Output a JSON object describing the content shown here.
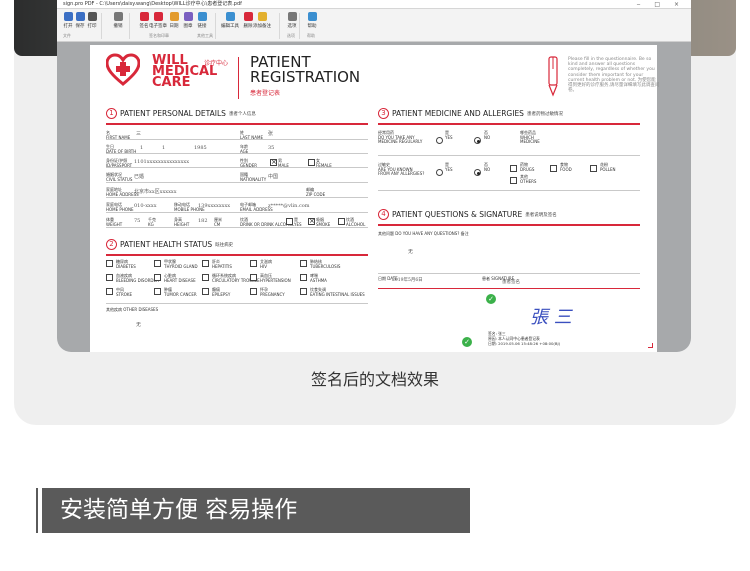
{
  "window": {
    "title": "sign.pro PDF  -  C:\\Users\\daisy.wang\\Desktop\\WILL诊疗中心\\患者登记表.pdf",
    "controls": "‒ □ ×"
  },
  "toolbar": {
    "tools": [
      "打开",
      "保存",
      "打印",
      "撤销",
      "签名",
      "电子签章",
      "日期",
      "图章",
      "链接",
      "编辑工具",
      "删除",
      "添加备注",
      "选项",
      "帮助"
    ],
    "groups": [
      "文件",
      "签名和印章",
      "其他工具",
      "选项",
      "帮助"
    ]
  },
  "document": {
    "brand_line1": "WILL",
    "brand_line2": "MEDICAL",
    "brand_line3": "CARE",
    "brand_cn": "诊疗中心",
    "reg_line1": "PATIENT",
    "reg_line2": "REGISTRATION",
    "reg_cn": "患者登记表",
    "notice": "Please fill in the questionnaire. Be so kind and answer all questions completely, regardless of whether you consider them important for your current health problem or not. 为使您能得到更好的诊疗服务,请尽量详细填写此调查问卷。",
    "sections": {
      "s1": {
        "num": "1",
        "title": "PATIENT PERSONAL DETAILS",
        "cn": "患者个人信息"
      },
      "s2": {
        "num": "2",
        "title": "PATIENT HEALTH STATUS",
        "cn": "既往病史"
      },
      "s3": {
        "num": "3",
        "title": "PATIENT MEDICINE AND ALLERGIES",
        "cn": "患者药物过敏情况"
      },
      "s4": {
        "num": "4",
        "title": "PATIENT QUESTIONS & SIGNATURE",
        "cn": "患者说明及签名"
      }
    },
    "personal": {
      "first_name_label": "名\nFIRST NAME",
      "first_name": "三",
      "last_name_label": "姓\nLAST NAME",
      "last_name": "张",
      "dob_label": "生日\nDATE OF BIRTH",
      "day": "1",
      "month": "1",
      "year": "1985",
      "age_label": "年龄\nAGE",
      "age": "35",
      "id_label": "身份证/护照\nID/PASSPORT",
      "id": "1101xxxxxxxxxxxxxxx",
      "gender_label": "性别\nGENDER",
      "male_label": "男\nMALE",
      "female_label": "女\nFEMALE",
      "civil_label": "婚姻状况\nCIVIL STATUS",
      "civil": "已婚",
      "nation_label": "国籍\nNATIONALITY",
      "nation": "中国",
      "address_label": "家庭地址\nHOME ADDRESS",
      "address": "北京市xx区xxxxxx",
      "zip_label": "邮编\nZIP CODE",
      "phone_label": "家庭电话\nHOME PHONE",
      "phone": "010-xxxx",
      "mobile_label": "移动电话\nMOBILE PHONE",
      "mobile": "139xxxxxxxx",
      "email_label": "电子邮箱\nEMAIL ADDRESS",
      "email": "z*****@vlin.com",
      "weight_label": "体重\nWEIGHT",
      "weight": "75",
      "weight_unit": "千克\nKG",
      "height_label": "身高\nHEIGHT",
      "height": "182",
      "height_unit": "厘米\nCM",
      "drink_label": "饮酒\nDRINK OR DRINK ALCOHOL",
      "yes_label": "是\nYES",
      "no_label": "否\nNO",
      "smoke_label": "吸烟\nSMOKE",
      "alcohol_label": "饮酒\nALCOHOL"
    },
    "health": {
      "items": [
        "糖尿病\nDIABETES",
        "甲状腺\nTHYROID GLAND",
        "肝炎\nHEPATITIS",
        "艾滋病\nHIV",
        "肺结核\nTUBERCULOSIS",
        "血液疾病\nBLEEDING DISORDER",
        "心脏病\nHEART DISEASE",
        "循环系统疾病\nCIRCULATORY TROUBLE",
        "高血压\nHYPERTENSION",
        "哮喘\nASTHMA",
        "中风\nSTROKE",
        "肿瘤\nTUMOR CANCER",
        "癫痫\nEPILEPSY",
        "怀孕\nPREGNANCY",
        "饮食失调\nEATING INTESTINAL ISSUES"
      ],
      "other_label": "其他疾病\nOTHER DISEASES",
      "other_value": "无"
    },
    "medicine": {
      "regular_label": "经常用药\nDO YOU TAKE ANY\nMEDICINE REGULARLY",
      "yes_label": "是\nYES",
      "no_label": "否\nNO",
      "which_label": "哪些药品\nWHICH\nMEDICINE",
      "allergy_label": "过敏史\nARE YOU KNOWN\nFROM ANY ALLERGIES?",
      "drugs_label": "药物\nDRUGS",
      "food_label": "食物\nFOOD",
      "pollen_label": "花粉\nPOLLEN",
      "others_label": "其他\nOTHERS"
    },
    "questions": {
      "q_label": "其他问题\nDO YOU HAVE\nANY QUESTIONS?\n备注",
      "q_value": "无",
      "date_label": "日期\nDATE",
      "date": "2019年5月6日",
      "patient_sig_label": "患者\nSIGNATURE",
      "patient_sig": "患者签名",
      "signature": "張 三",
      "stamp_line1": "签名: 张三",
      "stamp_line2": "原因: 本人认同中心患者登记表",
      "stamp_line3": "日期: 2019.05.06 15:48:26 +08:00(BJ)"
    }
  },
  "caption": "签名后的文档效果",
  "banner": {
    "text": "安装简单方便 容易操作"
  },
  "colors": {
    "brand_red": "#d8283a",
    "banner_bg": "#5a5a5a",
    "sig_blue": "#3a4fbf",
    "check_green": "#3bb14a"
  }
}
